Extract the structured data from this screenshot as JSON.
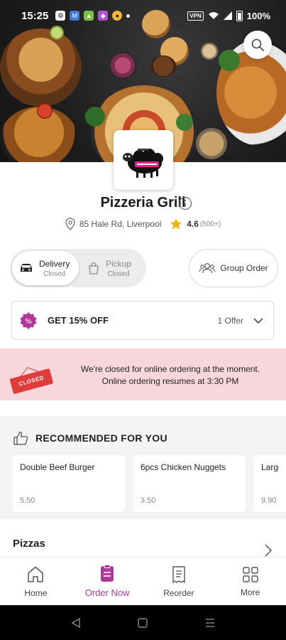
{
  "status_bar": {
    "time": "15:25",
    "app_icons": [
      "settings-icon",
      "meet-icon",
      "android-icon",
      "app-icon",
      "chrome-icon",
      "dot-icon"
    ],
    "vpn": "VPN",
    "battery": "100%"
  },
  "store": {
    "name": "Pizzeria Grill",
    "address": "85 Hale Rd, Liverpool",
    "rating": "4.6",
    "rating_count": "(500+)"
  },
  "order_mode": {
    "delivery": {
      "label": "Delivery",
      "status": "Closed"
    },
    "pickup": {
      "label": "Pickup",
      "status": "Closed"
    },
    "group_order": "Group Order"
  },
  "offer": {
    "title": "GET 15% OFF",
    "count": "1 Offer",
    "badge": "%"
  },
  "closed_banner": {
    "sign": "CLOSED",
    "line1": "We're closed for online ordering at the moment.",
    "line2": "Online ordering resumes at 3:30 PM"
  },
  "recommended": {
    "title": "RECOMMENDED FOR YOU",
    "items": [
      {
        "name": "Double Beef Burger",
        "price": "5.50"
      },
      {
        "name": "6pcs Chicken Nuggets",
        "price": "3.50"
      },
      {
        "name": "Large",
        "price": "9.90"
      }
    ]
  },
  "categories": {
    "first": "Pizzas"
  },
  "bottom_nav": [
    {
      "label": "Home",
      "icon": "home-icon"
    },
    {
      "label": "Order Now",
      "icon": "order-icon",
      "active": true
    },
    {
      "label": "Reorder",
      "icon": "receipt-icon"
    },
    {
      "label": "More",
      "icon": "grid-icon"
    }
  ],
  "colors": {
    "accent": "#b1379a",
    "closed_banner": "#f8d7dc",
    "closed_sign": "#e03a3a",
    "star": "#f5b400"
  }
}
